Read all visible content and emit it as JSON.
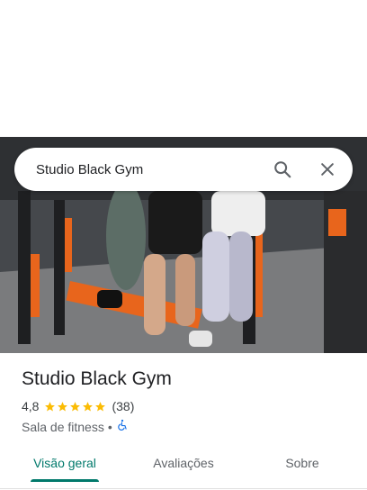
{
  "search": {
    "query": "Studio Black Gym"
  },
  "place": {
    "name": "Studio Black Gym",
    "rating": "4,8",
    "rating_value": 4.8,
    "stars_filled": 5,
    "review_count": "(38)",
    "category": "Sala de fitness",
    "separator": "•",
    "accessibility_icon": "wheelchair-icon"
  },
  "tabs": [
    {
      "label": "Visão geral",
      "active": true
    },
    {
      "label": "Avaliações",
      "active": false
    },
    {
      "label": "Sobre",
      "active": false
    }
  ],
  "colors": {
    "accent": "#00796b",
    "star": "#fbbc04",
    "accessibility": "#1a73e8",
    "gym_orange": "#e8651c"
  }
}
